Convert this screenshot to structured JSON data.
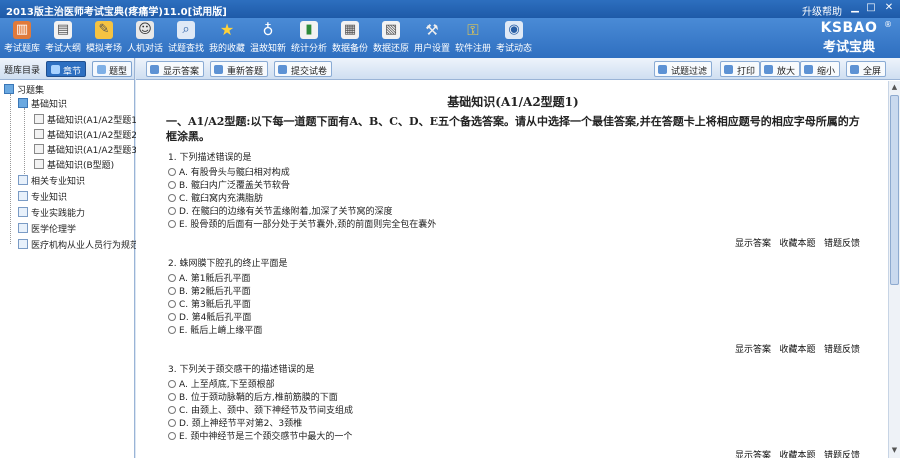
{
  "titlebar": {
    "title": "2013版主治医师考试宝典(疼痛学)11.0[试用版]",
    "help": "升级帮助"
  },
  "toolbar": {
    "items": [
      {
        "label": "考试题库",
        "icon": "question-bank-icon"
      },
      {
        "label": "考试大纲",
        "icon": "syllabus-icon"
      },
      {
        "label": "模拟考场",
        "icon": "exam-room-icon"
      },
      {
        "label": "人机对话",
        "icon": "dialog-icon"
      },
      {
        "label": "试题查找",
        "icon": "search-icon"
      },
      {
        "label": "我的收藏",
        "icon": "star-icon"
      },
      {
        "label": "温故知新",
        "icon": "bulb-icon"
      },
      {
        "label": "统计分析",
        "icon": "chart-icon"
      },
      {
        "label": "数据备份",
        "icon": "backup-icon"
      },
      {
        "label": "数据还原",
        "icon": "restore-icon"
      },
      {
        "label": "用户设置",
        "icon": "hammer-icon"
      },
      {
        "label": "软件注册",
        "icon": "key-icon"
      },
      {
        "label": "考试动态",
        "icon": "news-icon"
      }
    ],
    "brand_top": "KSBAO",
    "brand_bottom": "考试宝典",
    "brand_reg": "®"
  },
  "left": {
    "header_label": "题库目录",
    "tab_chapter": "章节",
    "tab_type": "题型",
    "tree": {
      "root": "习题集",
      "basic": "基础知识",
      "basic_children": [
        "基础知识(A1/A2型题1)",
        "基础知识(A1/A2型题2)",
        "基础知识(A1/A2型题3)",
        "基础知识(B型题)"
      ],
      "others": [
        "相关专业知识",
        "专业知识",
        "专业实践能力",
        "医学伦理学",
        "医疗机构从业人员行为规范"
      ]
    }
  },
  "right_toolbar": {
    "show_answer": "显示答案",
    "redo": "重新答题",
    "submit": "提交试卷",
    "filter": "试题过滤",
    "print": "打印",
    "zoom_in": "放大",
    "zoom_out": "缩小",
    "fullscreen": "全屏"
  },
  "content": {
    "section_title": "基础知识(A1/A2型题1)",
    "instruction": "一、A1/A2型题:以下每一道题下面有A、B、C、D、E五个备选答案。请从中选择一个最佳答案,并在答题卡上将相应题号的相应字母所属的方框涂黑。",
    "actions": [
      "显示答案",
      "收藏本题",
      "错题反馈"
    ],
    "questions": [
      {
        "text": "1. 下列描述错误的是",
        "options": [
          "A. 有股骨头与髋臼相对构成",
          "B. 髋臼内广泛覆盖关节软骨",
          "C. 髋臼窝内充满脂肪",
          "D. 在髋臼的边缘有关节盂缘附着,加深了关节窝的深度",
          "E. 股骨颈的后面有一部分处于关节囊外,颈的前面则完全包在囊外"
        ]
      },
      {
        "text": "2. 蛛网膜下腔孔的终止平面是",
        "options": [
          "A. 第1骶后孔平面",
          "B. 第2骶后孔平面",
          "C. 第3骶后孔平面",
          "D. 第4骶后孔平面",
          "E. 骶后上嵴上缘平面"
        ]
      },
      {
        "text": "3. 下列关于颈交感干的描述错误的是",
        "options": [
          "A. 上至颅底,下至颈根部",
          "B. 位于颈动脉鞘的后方,椎前筋膜的下面",
          "C. 由颈上、颈中、颈下神经节及节间支组成",
          "D. 颈上神经节平对第2、3颈椎",
          "E. 颈中神经节是三个颈交感节中最大的一个"
        ]
      }
    ]
  }
}
